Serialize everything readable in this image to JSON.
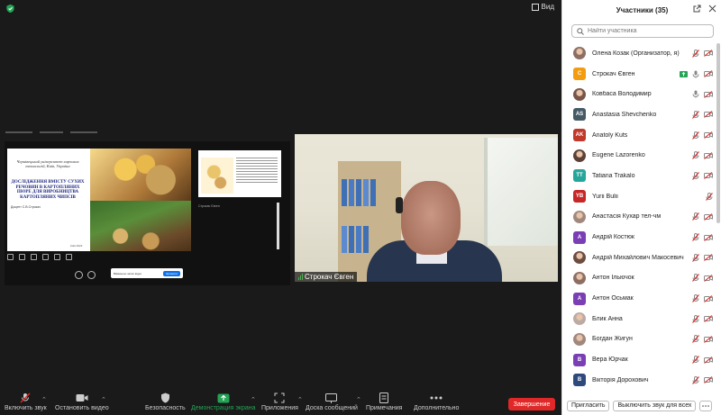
{
  "top": {
    "view_label": "Вид"
  },
  "share": {
    "slide": {
      "university": "Чернівецький університет харчових технологій, Київ, Україна",
      "title": "ДОСЛІДЖЕННЯ ВМІСТУ СУХИХ РЕЧОВИН В КАРТОПЛЯНИХ ПЮРЕ ДЛЯ ВИРОБНИЦТВА КАРТОПЛЯНИХ ЧИПСІВ",
      "author": "Доцент С.В.Строкач",
      "city": "Київ 2024"
    },
    "thumb_name": "Строкач Євген",
    "notif_text": "Ввімкнено запис відео",
    "notif_btn": "Зупинити"
  },
  "video": {
    "participant_name": "Строкач Євген"
  },
  "toolbar": {
    "items": [
      {
        "label": "Включить звук",
        "icon": "mic-muted-icon"
      },
      {
        "label": "Остановить видео",
        "icon": "camera-icon"
      },
      {
        "label": "Безопасность",
        "icon": "shield-icon"
      },
      {
        "label": "Демонстрация экрана",
        "icon": "share-screen-icon"
      },
      {
        "label": "Приложения",
        "icon": "apps-icon"
      },
      {
        "label": "Доска сообщений",
        "icon": "whiteboard-icon"
      },
      {
        "label": "Примечания",
        "icon": "notes-icon"
      },
      {
        "label": "Дополнительно",
        "icon": "more-icon"
      }
    ],
    "end_label": "Завершение"
  },
  "panel": {
    "title": "Участники (35)",
    "search_placeholder": "Найти участника",
    "participants": [
      {
        "name": "Олена Козак (Организатор, я)",
        "initials": "",
        "avatar_color": "#8d6e63",
        "photo": true,
        "mic": "muted",
        "video": "off"
      },
      {
        "name": "Строкач Євген",
        "initials": "С",
        "avatar_color": "#f39c12",
        "photo": false,
        "mic": "share",
        "video": "off"
      },
      {
        "name": "Ковбаса Володимир",
        "initials": "",
        "avatar_color": "#795548",
        "photo": true,
        "mic": "on",
        "video": "off"
      },
      {
        "name": "Anastasia Shevchenko",
        "initials": "AS",
        "avatar_color": "#455a64",
        "photo": false,
        "mic": "muted",
        "video": "off"
      },
      {
        "name": "Anatoly Kuts",
        "initials": "AK",
        "avatar_color": "#c0392b",
        "photo": false,
        "mic": "muted",
        "video": "off"
      },
      {
        "name": "Eugene Lazorenko",
        "initials": "",
        "avatar_color": "#5d4037",
        "photo": true,
        "mic": "muted",
        "video": "off"
      },
      {
        "name": "Tatiana Trakalo",
        "initials": "TT",
        "avatar_color": "#26a69a",
        "photo": false,
        "mic": "muted",
        "video": "off"
      },
      {
        "name": "Yurii Bulii",
        "initials": "YB",
        "avatar_color": "#c62828",
        "photo": false,
        "mic": "muted",
        "video": "none"
      },
      {
        "name": "Анастасія Кухар тел-чм",
        "initials": "",
        "avatar_color": "#a1887f",
        "photo": true,
        "mic": "muted",
        "video": "off"
      },
      {
        "name": "Андрій Костюк",
        "initials": "A",
        "avatar_color": "#7b3fb5",
        "photo": false,
        "mic": "muted",
        "video": "off"
      },
      {
        "name": "Андрій Михайлович Макосевич",
        "initials": "",
        "avatar_color": "#6d4c41",
        "photo": true,
        "mic": "muted",
        "video": "off"
      },
      {
        "name": "Антон Ільючок",
        "initials": "",
        "avatar_color": "#8d6e63",
        "photo": true,
        "mic": "muted",
        "video": "off"
      },
      {
        "name": "Антон Осьмак",
        "initials": "A",
        "avatar_color": "#7b3fb5",
        "photo": false,
        "mic": "muted",
        "video": "off"
      },
      {
        "name": "Блик Анна",
        "initials": "",
        "avatar_color": "#bcaaa4",
        "photo": true,
        "mic": "muted",
        "video": "off"
      },
      {
        "name": "Богдан Жигун",
        "initials": "",
        "avatar_color": "#a1887f",
        "photo": true,
        "mic": "muted",
        "video": "off"
      },
      {
        "name": "Вера Юрчак",
        "initials": "B",
        "avatar_color": "#7b3fb5",
        "photo": false,
        "mic": "muted",
        "video": "off"
      },
      {
        "name": "Вікторія Дорохович",
        "initials": "B",
        "avatar_color": "#2e4a7d",
        "photo": false,
        "mic": "muted",
        "video": "off"
      }
    ],
    "invite_label": "Пригласить",
    "mute_all_label": "Выключить звук для всех"
  },
  "colors": {
    "end": "#e02828",
    "accent": "#0e72ed",
    "muted": "#e02828",
    "share": "#23a455"
  }
}
